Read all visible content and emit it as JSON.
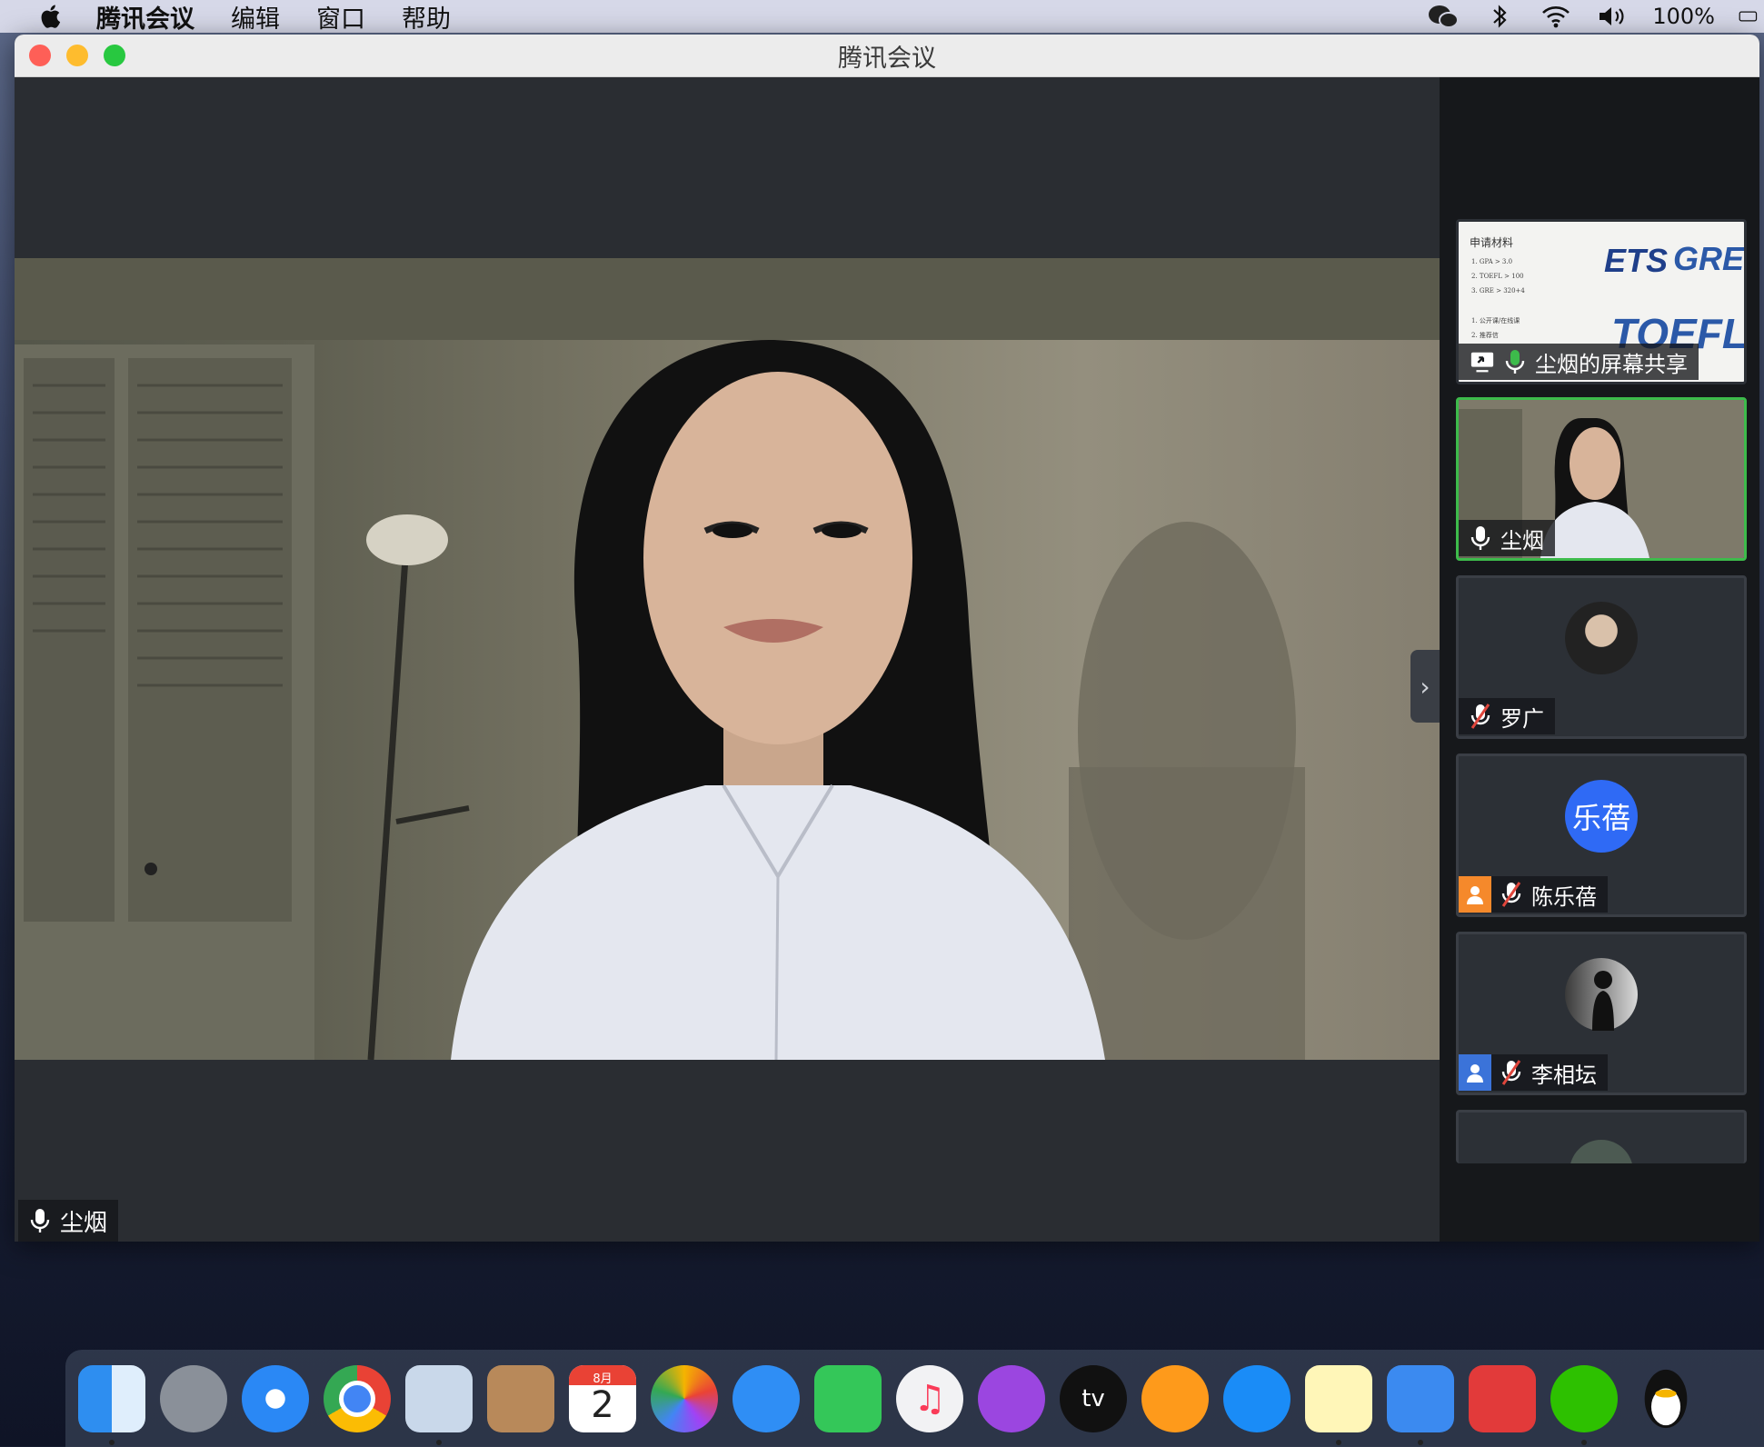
{
  "menubar": {
    "app_name": "腾讯会议",
    "items": [
      "编辑",
      "窗口",
      "帮助"
    ],
    "battery": "100%"
  },
  "window": {
    "title": "腾讯会议"
  },
  "main_speaker": {
    "name": "尘烟"
  },
  "participants": [
    {
      "name": "尘烟的屏幕共享",
      "kind": "screen-share"
    },
    {
      "name": "尘烟",
      "kind": "video",
      "active": true
    },
    {
      "name": "罗广",
      "kind": "avatar-photo",
      "muted": true
    },
    {
      "name": "陈乐蓓",
      "kind": "avatar-text",
      "avatar_text": "乐蓓",
      "muted": true
    },
    {
      "name": "李相坛",
      "kind": "avatar-silhouette",
      "muted": true
    }
  ],
  "shared_slide": {
    "title": "申请材料",
    "lines": [
      "1. GPA > 3.0",
      "2. TOEFL > 100",
      "3. GRE > 320+4",
      "1. 公开课/在线课",
      "2. 推荐信"
    ],
    "brand_ets": "ETS",
    "brand_gre": "GRE",
    "brand_toefl": "TOEFL"
  },
  "dock": {
    "apps": [
      "finder-icon",
      "launchpad-icon",
      "safari-icon",
      "chrome-icon",
      "preview-icon",
      "contacts-icon",
      "calendar-icon",
      "photos-icon",
      "messages-icon",
      "facetime-icon",
      "music-icon",
      "podcasts-icon",
      "appletv-icon",
      "books-icon",
      "appstore-icon",
      "notes-icon",
      "cloud-icon",
      "netease-music-icon",
      "wechat-icon",
      "qq-icon"
    ],
    "calendar_month": "8月",
    "calendar_day": "2",
    "appletv_label": "tv"
  },
  "colors": {
    "active_speaker_border": "#3dbb4b",
    "avatar_blue": "#2f6af5",
    "muted_red": "#e0463c"
  }
}
